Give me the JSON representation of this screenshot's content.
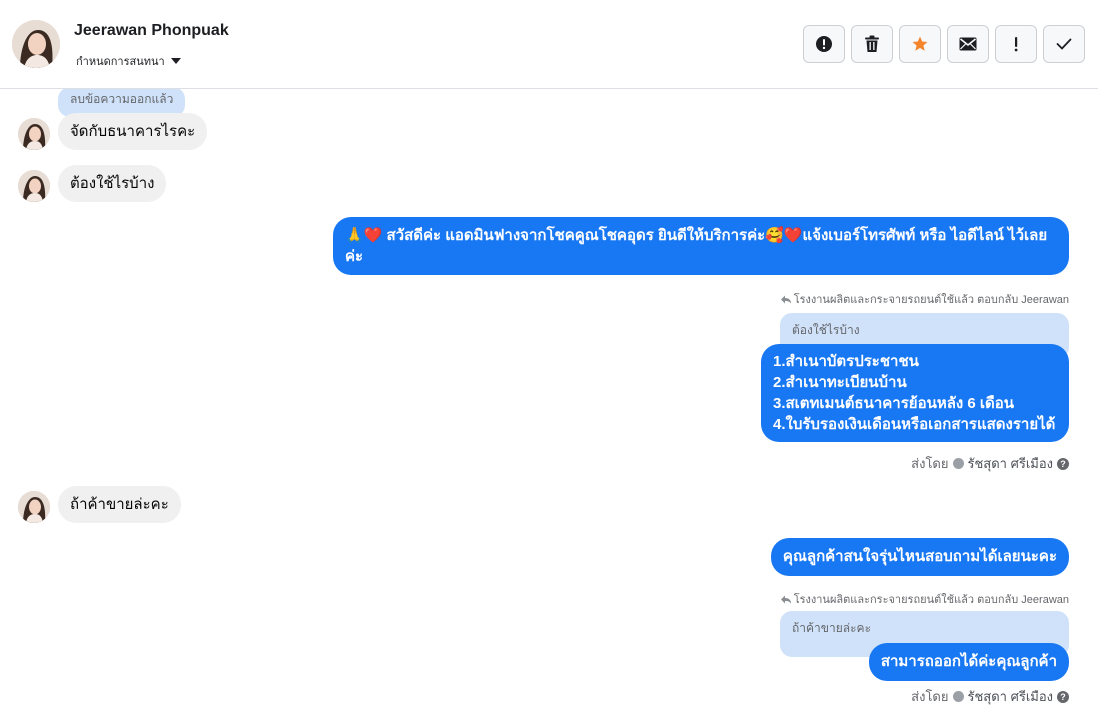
{
  "header": {
    "contact_name": "Jeerawan Phonpuak",
    "assign_label": "กำหนดการสนทนา",
    "actions": [
      {
        "name": "spam-button",
        "icon": "alert-circle-icon"
      },
      {
        "name": "delete-button",
        "icon": "trash-icon"
      },
      {
        "name": "star-button",
        "icon": "star-icon"
      },
      {
        "name": "mark-unread-button",
        "icon": "envelope-icon"
      },
      {
        "name": "follow-up-button",
        "icon": "exclamation-icon"
      },
      {
        "name": "mark-done-button",
        "icon": "check-icon"
      }
    ],
    "star_color": "#f5852b"
  },
  "messages": {
    "m1_quote": "ลบข้อความออกแล้ว",
    "m1_text": "จัดกับธนาคารไรคะ",
    "m2_text": "ต้องใช้ไรบ้าง",
    "m3_text": "🙏❤️ สวัสดีค่ะ แอดมินฟางจากโชคคูณโชคอุดร ยินดีให้บริการค่ะ🥰❤️แจ้งเบอร์โทรศัพท์ หรือ ไอดีไลน์ ไว้เลยค่ะ",
    "m4_reply_meta": "โรงงานผลิตและกระจายรถยนต์ใช้แล้ว ตอบกลับ Jeerawan",
    "m4_quote": "ต้องใช้ไรบ้าง",
    "m4_lines": [
      "1.สำเนาบัตรประชาชน",
      "2.สำเนาทะเบียนบ้าน",
      "3.สเตทเมนต์ธนาคารย้อนหลัง 6 เดือน",
      "4.ใบรับรองเงินเดือนหรือเอกสารแสดงรายได้"
    ],
    "sent_by_label": "ส่งโดย",
    "agent_name": "รัชสุดา ศรีเมือง",
    "m5_text": "ถ้าค้าขายล่ะคะ",
    "m6_text": "คุณลูกค้าสนใจรุ่นไหนสอบถามได้เลยนะคะ",
    "m7_reply_meta": "โรงงานผลิตและกระจายรถยนต์ใช้แล้ว ตอบกลับ Jeerawan",
    "m7_quote": "ถ้าค้าขายล่ะคะ",
    "m7_text": "สามารถออกได้ค่ะคุณลูกค้า"
  },
  "colors": {
    "outgoing": "#1877f2",
    "incoming": "#f0f0f0",
    "quote": "#d0e2f9"
  }
}
